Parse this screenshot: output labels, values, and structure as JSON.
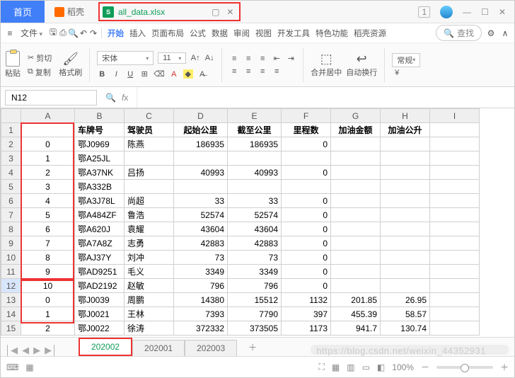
{
  "titlebar": {
    "home": "首页",
    "dk": "稻壳",
    "file": "all_data.xlsx",
    "badge": "1"
  },
  "menu": {
    "file": "文件",
    "items": [
      "开始",
      "插入",
      "页面布局",
      "公式",
      "数据",
      "审阅",
      "视图",
      "开发工具",
      "特色功能",
      "稻壳资源"
    ],
    "search": "查找"
  },
  "ribbon": {
    "cut": "剪切",
    "copy": "复制",
    "paste": "粘贴",
    "fmt": "格式刷",
    "font": "宋体",
    "size": "11",
    "merge": "合并居中",
    "wrap": "自动换行",
    "general": "常规"
  },
  "cellref": "N12",
  "columns": [
    "",
    "A",
    "B",
    "C",
    "D",
    "E",
    "F",
    "G",
    "H",
    "I"
  ],
  "headers": [
    "",
    "车牌号",
    "驾驶员",
    "起始公里",
    "截至公里",
    "里程数",
    "加油金额",
    "加油公升"
  ],
  "rows": [
    {
      "n": 1,
      "A": "",
      "B": "车牌号",
      "C": "驾驶员",
      "D": "起始公里",
      "E": "截至公里",
      "F": "里程数",
      "G": "加油金额",
      "H": "加油公升",
      "hdr": true
    },
    {
      "n": 2,
      "A": "0",
      "B": "鄂J0969",
      "C": "陈燕",
      "D": "186935",
      "E": "186935",
      "F": "0",
      "G": "",
      "H": ""
    },
    {
      "n": 3,
      "A": "1",
      "B": "鄂A25JL",
      "C": "",
      "D": "",
      "E": "",
      "F": "",
      "G": "",
      "H": ""
    },
    {
      "n": 4,
      "A": "2",
      "B": "鄂A37NK",
      "C": "吕扬",
      "D": "40993",
      "E": "40993",
      "F": "0",
      "G": "",
      "H": ""
    },
    {
      "n": 5,
      "A": "3",
      "B": "鄂A332B",
      "C": "",
      "D": "",
      "E": "",
      "F": "",
      "G": "",
      "H": ""
    },
    {
      "n": 6,
      "A": "4",
      "B": "鄂A3J78L",
      "C": "尚超",
      "D": "33",
      "E": "33",
      "F": "0",
      "G": "",
      "H": ""
    },
    {
      "n": 7,
      "A": "5",
      "B": "鄂A484ZF",
      "C": "鲁浩",
      "D": "52574",
      "E": "52574",
      "F": "0",
      "G": "",
      "H": ""
    },
    {
      "n": 8,
      "A": "6",
      "B": "鄂A620J",
      "C": "袁耀",
      "D": "43604",
      "E": "43604",
      "F": "0",
      "G": "",
      "H": ""
    },
    {
      "n": 9,
      "A": "7",
      "B": "鄂A7A8Z",
      "C": "志勇",
      "D": "42883",
      "E": "42883",
      "F": "0",
      "G": "",
      "H": ""
    },
    {
      "n": 10,
      "A": "8",
      "B": "鄂AJ37Y",
      "C": "刘冲",
      "D": "73",
      "E": "73",
      "F": "0",
      "G": "",
      "H": ""
    },
    {
      "n": 11,
      "A": "9",
      "B": "鄂AD9251",
      "C": "毛义",
      "D": "3349",
      "E": "3349",
      "F": "0",
      "G": "",
      "H": ""
    },
    {
      "n": 12,
      "A": "10",
      "B": "鄂AD2192",
      "C": "赵敏",
      "D": "796",
      "E": "796",
      "F": "0",
      "G": "",
      "H": "",
      "sel": true
    },
    {
      "n": 13,
      "A": "0",
      "B": "鄂J0039",
      "C": "周鹏",
      "D": "14380",
      "E": "15512",
      "F": "1132",
      "G": "201.85",
      "H": "26.95"
    },
    {
      "n": 14,
      "A": "1",
      "B": "鄂J0021",
      "C": "王林",
      "D": "7393",
      "E": "7790",
      "F": "397",
      "G": "455.39",
      "H": "58.57"
    },
    {
      "n": 15,
      "A": "2",
      "B": "鄂J0022",
      "C": "徐涛",
      "D": "372332",
      "E": "373505",
      "F": "1173",
      "G": "941.7",
      "H": "130.74"
    }
  ],
  "sheets": {
    "active": "202002",
    "others": [
      "202001",
      "202003"
    ]
  },
  "status": {
    "zoom": "100%"
  },
  "watermark": "https://blog.csdn.net/weixin_44352931"
}
